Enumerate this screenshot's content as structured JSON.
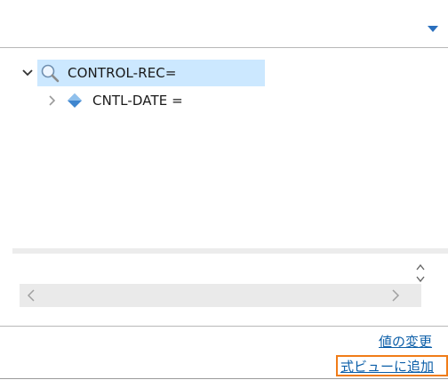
{
  "toolbar": {
    "view_menu_icon": "dropdown-triangle-icon",
    "accent_color": "#2a6fbd"
  },
  "tree": {
    "root": {
      "label": "CONTROL-REC=",
      "expanded": true,
      "selected": true,
      "icon": "search-icon"
    },
    "child": {
      "label": "CNTL-DATE =",
      "expanded": false,
      "icon": "diamond-variable-icon"
    }
  },
  "actions": {
    "change_value_link": "値の変更",
    "add_to_expressions_link": "式ビューに追加"
  },
  "colors": {
    "selection_bg": "#cce8ff",
    "link": "#0b5ea8",
    "focus_border": "#f07c18"
  }
}
